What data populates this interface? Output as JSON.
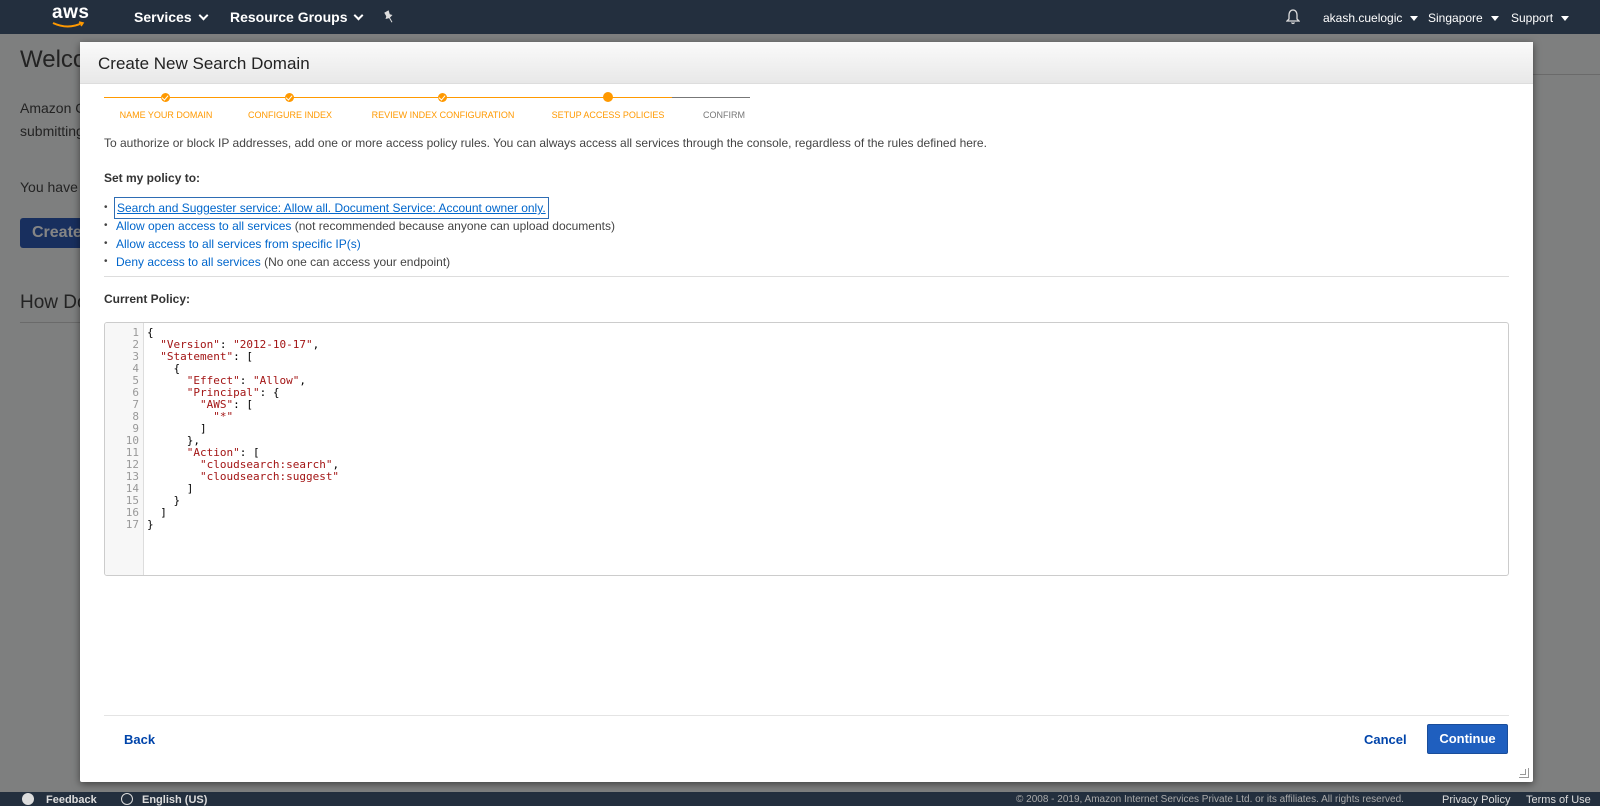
{
  "topnav": {
    "logo": "aws",
    "services": "Services",
    "resource_groups": "Resource Groups",
    "pin_icon": "pin-icon",
    "bell_icon": "bell-icon",
    "user": "akash.cuelogic",
    "region": "Singapore",
    "support": "Support"
  },
  "background": {
    "title": "Welco",
    "line1": "Amazon C",
    "line2": "submitting",
    "line3": "You have",
    "create_button": "Create",
    "section": "How Do"
  },
  "modal": {
    "title": "Create New Search Domain",
    "steps": [
      {
        "label": "NAME YOUR DOMAIN",
        "state": "done"
      },
      {
        "label": "CONFIGURE INDEX",
        "state": "done"
      },
      {
        "label": "REVIEW INDEX CONFIGURATION",
        "state": "done"
      },
      {
        "label": "SETUP ACCESS POLICIES",
        "state": "current"
      },
      {
        "label": "CONFIRM",
        "state": "pending"
      }
    ],
    "intro": "To authorize or block IP addresses, add one or more access policy rules. You can always access all services through the console, regardless of the rules defined here.",
    "policy_heading": "Set my policy to:",
    "policies": [
      {
        "link": "Search and Suggester service: Allow all. Document Service: Account owner only.",
        "note": ""
      },
      {
        "link": "Allow open access to all services",
        "note": " (not recommended because anyone can upload documents)"
      },
      {
        "link": "Allow access to all services from specific IP(s)",
        "note": ""
      },
      {
        "link": "Deny access to all services",
        "note": " (No one can access your endpoint)"
      }
    ],
    "current_policy_heading": "Current Policy:",
    "back": "Back",
    "cancel": "Cancel",
    "continue": "Continue"
  },
  "editor": {
    "line_numbers": [
      "1",
      "2",
      "3",
      "4",
      "5",
      "6",
      "7",
      "8",
      "9",
      "10",
      "11",
      "12",
      "13",
      "14",
      "15",
      "16",
      "17"
    ]
  },
  "footer": {
    "feedback": "Feedback",
    "language": "English (US)",
    "copyright": "© 2008 - 2019, Amazon Internet Services Private Ltd. or its affiliates. All rights reserved.",
    "privacy": "Privacy Policy",
    "terms": "Terms of Use"
  },
  "colors": {
    "nav_bg": "#232f3e",
    "step_accent": "#ff9900",
    "link": "#0066cc",
    "primary_button": "#1f5fbf"
  }
}
